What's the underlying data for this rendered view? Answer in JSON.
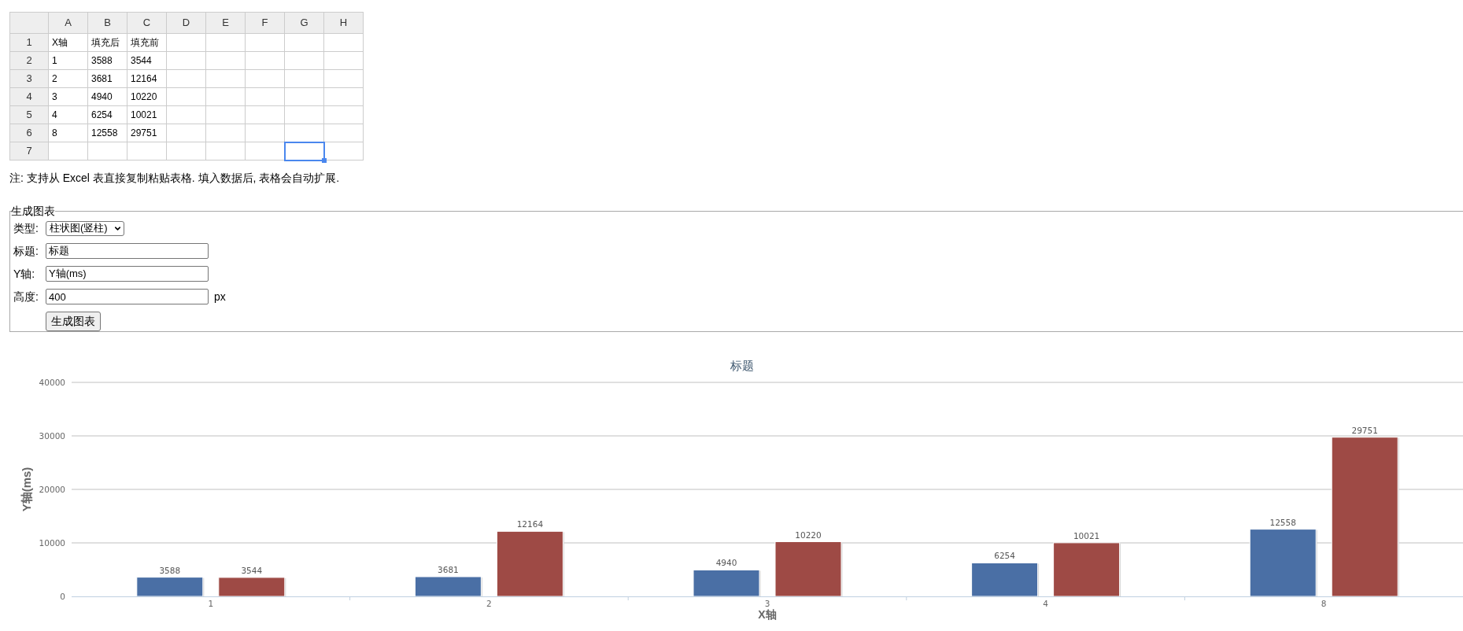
{
  "sheet": {
    "columns": [
      "A",
      "B",
      "C",
      "D",
      "E",
      "F",
      "G",
      "H"
    ],
    "rows": [
      {
        "label": "1",
        "cells": [
          {
            "text": "X轴",
            "selected": false
          },
          {
            "text": "填充后",
            "selected": false
          },
          {
            "text": "填充前",
            "selected": false
          },
          {
            "selected": false
          },
          {
            "selected": false
          },
          {
            "selected": false
          },
          {
            "selected": false
          },
          {
            "selected": false
          }
        ]
      },
      {
        "label": "2",
        "cells": [
          {
            "text": "1",
            "selected": false
          },
          {
            "text": "3588",
            "selected": false
          },
          {
            "text": "3544",
            "selected": false
          },
          {
            "selected": false
          },
          {
            "selected": false
          },
          {
            "selected": false
          },
          {
            "selected": false
          },
          {
            "selected": false
          }
        ]
      },
      {
        "label": "3",
        "cells": [
          {
            "text": "2",
            "selected": false
          },
          {
            "text": "3681",
            "selected": false
          },
          {
            "text": "12164",
            "selected": false
          },
          {
            "selected": false
          },
          {
            "selected": false
          },
          {
            "selected": false
          },
          {
            "selected": false
          },
          {
            "selected": false
          }
        ]
      },
      {
        "label": "4",
        "cells": [
          {
            "text": "3",
            "selected": false
          },
          {
            "text": "4940",
            "selected": false
          },
          {
            "text": "10220",
            "selected": false
          },
          {
            "selected": false
          },
          {
            "selected": false
          },
          {
            "selected": false
          },
          {
            "selected": false
          },
          {
            "selected": false
          }
        ]
      },
      {
        "label": "5",
        "cells": [
          {
            "text": "4",
            "selected": false
          },
          {
            "text": "6254",
            "selected": false
          },
          {
            "text": "10021",
            "selected": false
          },
          {
            "selected": false
          },
          {
            "selected": false
          },
          {
            "selected": false
          },
          {
            "selected": false
          },
          {
            "selected": false
          }
        ]
      },
      {
        "label": "6",
        "cells": [
          {
            "text": "8",
            "selected": false
          },
          {
            "text": "12558",
            "selected": false
          },
          {
            "text": "29751",
            "selected": false
          },
          {
            "selected": false
          },
          {
            "selected": false
          },
          {
            "selected": false
          },
          {
            "selected": false
          },
          {
            "selected": false
          }
        ]
      },
      {
        "label": "7",
        "cells": [
          {
            "selected": false
          },
          {
            "selected": false
          },
          {
            "selected": false
          },
          {
            "selected": false
          },
          {
            "selected": false
          },
          {
            "selected": false
          },
          {
            "selected": true
          },
          {
            "selected": false
          }
        ]
      }
    ]
  },
  "note": "注: 支持从 Excel 表直接复制粘贴表格. 填入数据后, 表格会自动扩展.",
  "form": {
    "legend": "生成图表",
    "fields": [
      {
        "kind": "select",
        "label": "类型:",
        "value": "柱状图(竖柱)"
      },
      {
        "kind": "text",
        "label": "标题:",
        "value": "标题"
      },
      {
        "kind": "text",
        "label": "Y轴:",
        "value": "Y轴(ms)"
      },
      {
        "kind": "text",
        "label": "高度:",
        "value": "400",
        "unit": "px"
      }
    ],
    "button": "生成图表"
  },
  "chart": {
    "chart_data": {
      "type": "bar",
      "title": "标题",
      "xlabel": "X轴",
      "ylabel": "Y轴(ms)",
      "categories": [
        "1",
        "2",
        "3",
        "4",
        "8"
      ],
      "series": [
        {
          "color": "#4a6fa5",
          "values": [
            3588,
            3681,
            4940,
            6254,
            12558
          ]
        },
        {
          "color": "#9e4a45",
          "values": [
            3544,
            12164,
            10220,
            10021,
            29751
          ]
        }
      ],
      "ylim": [
        0,
        40000
      ],
      "yticks": [
        0,
        10000,
        20000,
        30000,
        40000
      ],
      "grid": true,
      "data_labels": true
    }
  }
}
